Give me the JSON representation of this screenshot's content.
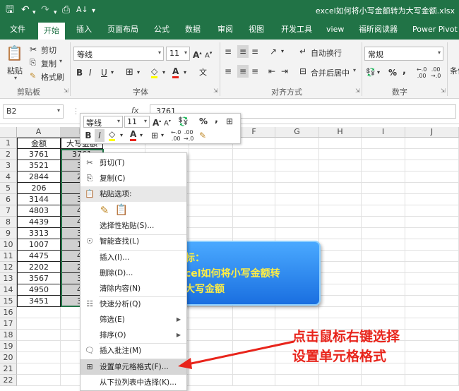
{
  "titlebar": {
    "filename": "excel如何将小写金额转为大写金额.xlsx"
  },
  "tabs": [
    "文件",
    "开始",
    "插入",
    "页面布局",
    "公式",
    "数据",
    "审阅",
    "视图",
    "开发工具",
    "view",
    "福昕阅读器",
    "Power Pivot"
  ],
  "ribbon": {
    "clipboard": {
      "paste": "粘贴",
      "cut": "剪切",
      "copy": "复制",
      "format_painter": "格式刷",
      "group": "剪贴板"
    },
    "font": {
      "name": "等线",
      "size": "11",
      "bold": "B",
      "italic": "I",
      "underline": "U",
      "grow": "A",
      "shrink": "A",
      "group": "字体"
    },
    "align": {
      "wrap": "自动换行",
      "merge": "合并后居中",
      "group": "对齐方式"
    },
    "number": {
      "format": "常规",
      "percent": "%",
      "comma": ",",
      "group": "数字"
    },
    "cond": "条件"
  },
  "formula_bar": {
    "namebox": "B2",
    "value": "3761",
    "fx": "fx"
  },
  "mini_toolbar": {
    "font": "等线",
    "size": "11",
    "percent": "%",
    "comma": ",",
    "bold": "B",
    "italic": "I"
  },
  "columns": [
    "A",
    "B",
    "C",
    "D",
    "E",
    "F",
    "G",
    "H",
    "I",
    "J"
  ],
  "rows": [
    "1",
    "2",
    "3",
    "4",
    "5",
    "6",
    "7",
    "8",
    "9",
    "10",
    "11",
    "12",
    "13",
    "14",
    "15",
    "16",
    "17",
    "18",
    "19",
    "20",
    "21",
    "22"
  ],
  "cells": {
    "A": [
      "金额",
      "3761",
      "3521",
      "2844",
      "206",
      "3144",
      "4803",
      "4439",
      "3313",
      "1007",
      "4475",
      "2202",
      "3567",
      "4950",
      "3451"
    ],
    "B": [
      "大写金额",
      "3761",
      "35",
      "28",
      "2",
      "31",
      "48",
      "44",
      "33",
      "10",
      "44",
      "22",
      "35",
      "49",
      "34"
    ]
  },
  "context_menu": [
    {
      "label": "剪切(T)",
      "icon": "scissors-icon"
    },
    {
      "label": "复制(C)",
      "icon": "copy-icon"
    },
    {
      "label": "粘贴选项:",
      "icon": "paste-icon"
    },
    {
      "label": "选择性粘贴(S)...",
      "icon": ""
    },
    {
      "label": "智能查找(L)",
      "icon": "search-icon"
    },
    {
      "label": "插入(I)...",
      "icon": ""
    },
    {
      "label": "删除(D)...",
      "icon": ""
    },
    {
      "label": "清除内容(N)",
      "icon": ""
    },
    {
      "label": "快速分析(Q)",
      "icon": "quick-analysis-icon"
    },
    {
      "label": "筛选(E)",
      "icon": ""
    },
    {
      "label": "排序(O)",
      "icon": ""
    },
    {
      "label": "插入批注(M)",
      "icon": "comment-icon"
    },
    {
      "label": "设置单元格格式(F)...",
      "icon": "format-cells-icon"
    },
    {
      "label": "从下拉列表中选择(K)...",
      "icon": ""
    }
  ],
  "callout": {
    "line1": "标：",
    "line2": "cel如何将小写金额转",
    "line3": "大写金额"
  },
  "annotation": {
    "line1": "点击鼠标右键选择",
    "line2": "设置单元格格式"
  },
  "colors": {
    "excel_green": "#217346",
    "annotation_red": "#e8241b",
    "callout_blue": "#2b86f0"
  }
}
